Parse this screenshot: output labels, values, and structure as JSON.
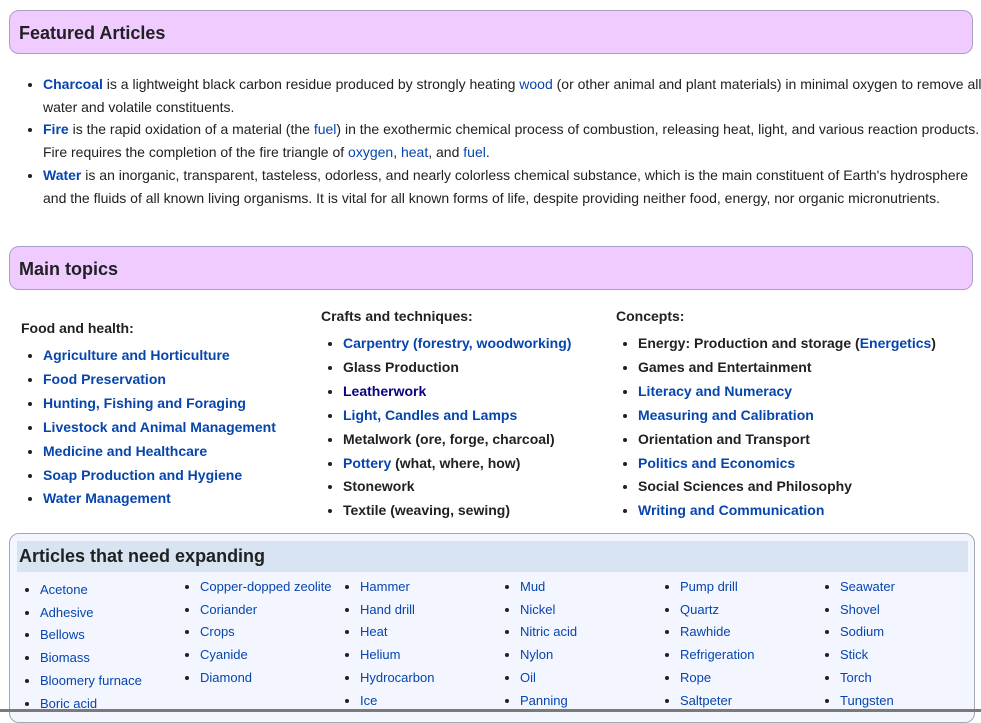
{
  "featured": {
    "title": "Featured Articles",
    "items": [
      [
        {
          "t": "Charcoal",
          "link": true,
          "bold": true
        },
        {
          "t": " is a lightweight black carbon residue produced by strongly heating "
        },
        {
          "t": "wood",
          "link": true
        },
        {
          "t": " (or other animal and plant materials) in minimal oxygen to remove all water and volatile constituents."
        }
      ],
      [
        {
          "t": "Fire",
          "link": true,
          "bold": true
        },
        {
          "t": " is the rapid oxidation of a material (the "
        },
        {
          "t": "fuel",
          "link": true
        },
        {
          "t": ") in the exothermic chemical process of combustion, releasing heat, light, and various reaction products. Fire requires the completion of the fire triangle of "
        },
        {
          "t": "oxygen",
          "link": true
        },
        {
          "t": ", "
        },
        {
          "t": "heat",
          "link": true
        },
        {
          "t": ", and "
        },
        {
          "t": "fuel",
          "link": true
        },
        {
          "t": "."
        }
      ],
      [
        {
          "t": "Water",
          "link": true,
          "bold": true
        },
        {
          "t": " is an inorganic, transparent, tasteless, odorless, and nearly colorless chemical substance, which is the main constituent of Earth's hydrosphere and the fluids of all known living organisms. It is vital for all known forms of life, despite providing neither food, energy, nor organic micronutrients."
        }
      ]
    ]
  },
  "topics": {
    "title": "Main topics",
    "columns": [
      {
        "title": "Food and health:",
        "items": [
          [
            {
              "t": "Agriculture and Horticulture",
              "link": true
            }
          ],
          [
            {
              "t": "Food Preservation",
              "link": true
            }
          ],
          [
            {
              "t": "Hunting, Fishing and Foraging",
              "link": true
            }
          ],
          [
            {
              "t": "Livestock and Animal Management",
              "link": true
            }
          ],
          [
            {
              "t": "Medicine and Healthcare",
              "link": true
            }
          ],
          [
            {
              "t": "Soap Production and Hygiene",
              "link": true
            }
          ],
          [
            {
              "t": "Water Management",
              "link": true
            }
          ]
        ]
      },
      {
        "title": "Crafts and techniques:",
        "items": [
          [
            {
              "t": "Carpentry (forestry, woodworking)",
              "link": true
            }
          ],
          [
            {
              "t": "Glass Production"
            }
          ],
          [
            {
              "t": "Leatherwork",
              "link": true,
              "visited": true
            }
          ],
          [
            {
              "t": "Light, Candles and Lamps",
              "link": true
            }
          ],
          [
            {
              "t": "Metalwork (ore, forge, charcoal)"
            }
          ],
          [
            {
              "t": "Pottery",
              "link": true
            },
            {
              "t": " (what, where, how)"
            }
          ],
          [
            {
              "t": "Stonework"
            }
          ],
          [
            {
              "t": "Textile (weaving, sewing)"
            }
          ]
        ]
      },
      {
        "title": "Concepts:",
        "items": [
          [
            {
              "t": "Energy: Production and storage ("
            },
            {
              "t": "Energetics",
              "link": true
            },
            {
              "t": ")"
            }
          ],
          [
            {
              "t": "Games and Entertainment"
            }
          ],
          [
            {
              "t": "Literacy and Numeracy",
              "link": true
            }
          ],
          [
            {
              "t": "Measuring and Calibration",
              "link": true
            }
          ],
          [
            {
              "t": "Orientation and Transport"
            }
          ],
          [
            {
              "t": "Politics and Economics",
              "link": true
            }
          ],
          [
            {
              "t": "Social Sciences and Philosophy"
            }
          ],
          [
            {
              "t": "Writing and Communication",
              "link": true
            }
          ]
        ]
      }
    ]
  },
  "expanding": {
    "title": "Articles that need expanding",
    "columns": [
      [
        "Acetone",
        "Adhesive",
        "Bellows",
        "Biomass",
        "Bloomery furnace",
        "Boric acid"
      ],
      [
        "Copper-dopped zeolite",
        "Coriander",
        "Crops",
        "Cyanide",
        "Diamond"
      ],
      [
        "Hammer",
        "Hand drill",
        "Heat",
        "Helium",
        "Hydrocarbon",
        "Ice"
      ],
      [
        "Mud",
        "Nickel",
        "Nitric acid",
        "Nylon",
        "Oil",
        "Panning"
      ],
      [
        "Pump drill",
        "Quartz",
        "Rawhide",
        "Refrigeration",
        "Rope",
        "Saltpeter"
      ],
      [
        "Seawater",
        "Shovel",
        "Sodium",
        "Stick",
        "Torch",
        "Tungsten"
      ]
    ]
  }
}
